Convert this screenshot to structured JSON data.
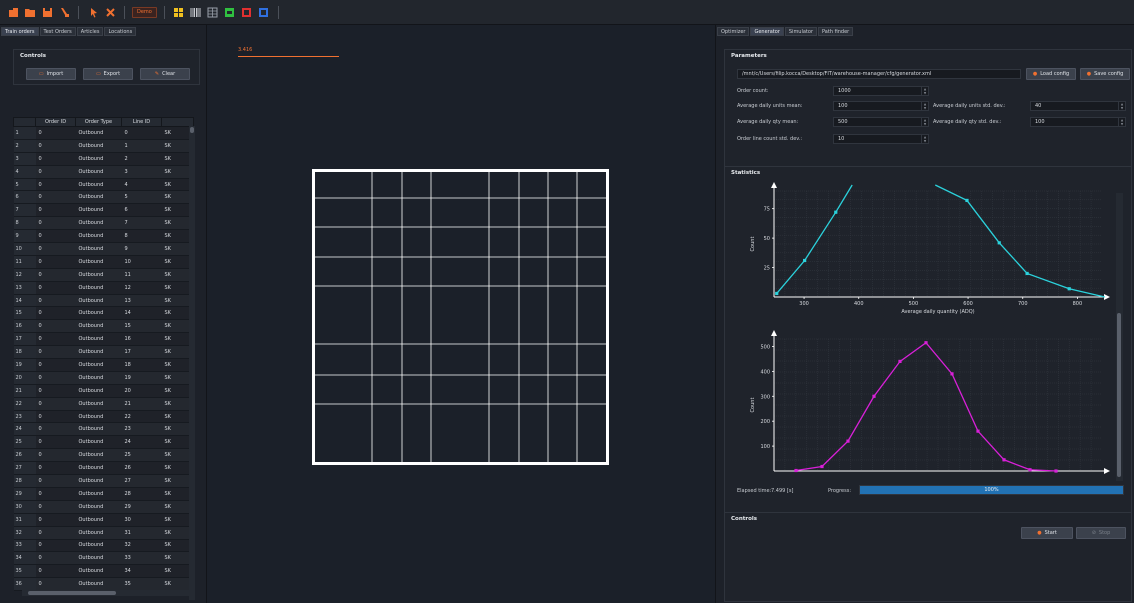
{
  "toolbar": {
    "demo_label": "Demo",
    "colors": {
      "orange": "#f07030",
      "yellow": "#f0c020",
      "green": "#30c040",
      "red": "#e03030",
      "blue": "#3070e0"
    }
  },
  "left": {
    "tabs": [
      {
        "label": "Train orders",
        "active": true
      },
      {
        "label": "Test Orders",
        "active": false
      },
      {
        "label": "Articles",
        "active": false
      },
      {
        "label": "Locations",
        "active": false
      }
    ],
    "controls_title": "Controls",
    "buttons": {
      "import": "Import",
      "export": "Export",
      "clear": "Clear"
    },
    "table": {
      "columns": [
        "Order ID",
        "Order Type",
        "Line ID",
        ""
      ],
      "row_count": 36,
      "order_id": "0",
      "order_type": "Outbound",
      "sku_prefix": "SK"
    }
  },
  "center": {
    "readout": "3.416"
  },
  "right": {
    "tabs": [
      {
        "label": "Optimizer",
        "active": false
      },
      {
        "label": "Generator",
        "active": true
      },
      {
        "label": "Simulator",
        "active": false
      },
      {
        "label": "Path finder",
        "active": false
      }
    ],
    "parameters_title": "Parameters",
    "config_path": "/mnt/c/Users/filip.kocca/Desktop/FIT/warehouse-manager/cfg/generator.xml",
    "load_config": "Load config",
    "save_config": "Save config",
    "fields": {
      "order_count_label": "Order count:",
      "order_count": "1000",
      "units_mean_label": "Average daily units mean:",
      "units_mean": "100",
      "units_std_label": "Average daily units std. dev.:",
      "units_std": "40",
      "qty_mean_label": "Average daily qty mean:",
      "qty_mean": "500",
      "qty_std_label": "Average daily qty std. dev.:",
      "qty_std": "100",
      "line_std_label": "Order line count std. dev.:",
      "line_std": "10"
    },
    "statistics_title": "Statistics",
    "elapsed_label": "Elapsed time:",
    "elapsed_value": "7.499 [s]",
    "progress_label": "Progress:",
    "progress_text": "100%",
    "progress_fraction": 1.0,
    "controls_title": "Controls",
    "start_label": "Start",
    "stop_label": "Stop"
  },
  "chart_data": [
    {
      "type": "line",
      "xlabel": "Average daily quantity (ADQ)",
      "ylabel": "Count",
      "x_ticks": [
        300,
        400,
        500,
        600,
        700,
        800
      ],
      "y_ticks": [
        25,
        50,
        75
      ],
      "xlim": [
        245,
        845
      ],
      "ylim": [
        0,
        90
      ],
      "color": "#2bd2dc",
      "series": [
        {
          "x": [
            250,
            301,
            358,
            388
          ],
          "y": [
            3,
            31,
            72,
            96
          ]
        },
        {
          "x": [
            540,
            598,
            657,
            708,
            785,
            850
          ],
          "y": [
            96,
            82,
            46,
            20,
            7,
            0
          ]
        }
      ]
    },
    {
      "type": "line",
      "xlabel": "",
      "ylabel": "Count",
      "y_ticks": [
        100,
        200,
        300,
        400,
        500
      ],
      "ylim": [
        0,
        530
      ],
      "color": "#d820d8",
      "x": [
        1,
        2,
        3,
        4,
        5,
        6,
        7,
        8,
        9,
        10,
        11
      ],
      "y": [
        2,
        18,
        120,
        300,
        440,
        515,
        390,
        160,
        45,
        5,
        0
      ]
    }
  ]
}
